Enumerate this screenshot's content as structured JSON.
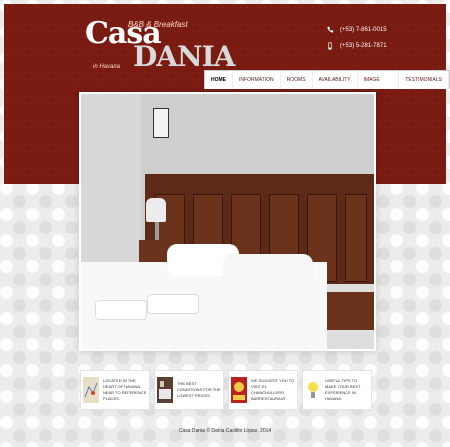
{
  "logo": {
    "word1": "Casa",
    "word2": "DANIA",
    "tagline": "B&B & Breakfast",
    "location": "in Havana"
  },
  "contact": {
    "phone1": "(+53) 7-861-0015",
    "phone2": "(+53) 5-281-7871"
  },
  "nav": {
    "items": [
      "Home",
      "Information",
      "Rooms",
      "Availability",
      "Image Tour",
      "Testimonials"
    ],
    "active_index": 0
  },
  "features": [
    {
      "text": "Located in the heart of Havana Near to reference places."
    },
    {
      "text": "The best conditions for the lowest prices."
    },
    {
      "text": "We suggest you to visit El Chanchullero BarRestaurant."
    },
    {
      "text": "Useful tips to make your best experience in Havana."
    }
  ],
  "footer": {
    "text": "Casa Dania © Dania Castillo López. 2014"
  },
  "colors": {
    "header_bg": "#7a1b12",
    "nav_text": "#5a1b14"
  }
}
